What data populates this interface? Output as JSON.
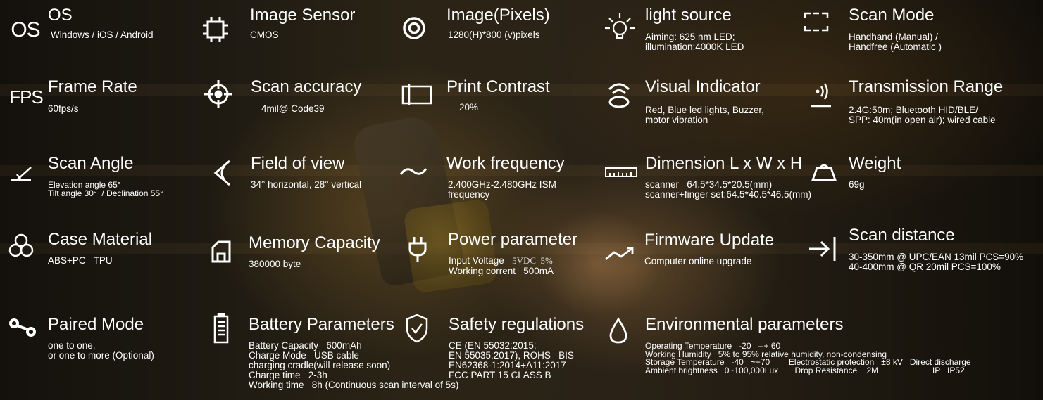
{
  "items": {
    "os": {
      "title": "OS",
      "icon_text": "OS",
      "icon": "os-text-icon",
      "text": "Windows / iOS / Android"
    },
    "image_sensor": {
      "title": "Image Sensor",
      "icon": "chip-icon",
      "text": "CMOS"
    },
    "image_pixels": {
      "title": "Image(Pixels)",
      "icon": "target-circle-icon",
      "text": "1280(H)*800 (v)pixels"
    },
    "light_source": {
      "title": "light source",
      "icon": "light-bulb-icon",
      "text": "Aiming: 625 nm LED;\nillumination:4000K LED"
    },
    "scan_mode": {
      "title": "Scan Mode",
      "icon": "scan-frame-icon",
      "text": "Handhand (Manual) /\nHandfree (Automatic )"
    },
    "frame_rate": {
      "title": "Frame Rate",
      "icon_text": "FPS",
      "icon": "fps-text-icon",
      "text": "60fps/s"
    },
    "scan_accuracy": {
      "title": "Scan accuracy",
      "icon": "crosshair-icon",
      "text": "4mil@ Code39"
    },
    "print_contrast": {
      "title": "Print Contrast",
      "icon": "contrast-rectangle-icon",
      "text": "20%"
    },
    "visual_indicator": {
      "title": "Visual Indicator",
      "icon": "signal-indicator-icon",
      "text": "Red, Blue led lights, Buzzer,\nmotor vibration"
    },
    "transmission_range": {
      "title": "Transmission Range",
      "icon": "wireless-transmit-icon",
      "text": "2.4G:50m; Bluetooth HID/BLE/\nSPP: 40m(in open air); wired cable"
    },
    "scan_angle": {
      "title": "Scan Angle",
      "icon": "angle-icon",
      "text": "Elevation angle 65°\nTilt angle 30°  / Declination 55°"
    },
    "field_of_view": {
      "title": "Field of view",
      "icon": "field-of-view-icon",
      "text": "34° horizontal, 28° vertical"
    },
    "work_frequency": {
      "title": "Work frequency",
      "icon": "wave-icon",
      "text": "2.400GHz-2.480GHz ISM\nfrequency"
    },
    "dimension": {
      "title": "Dimension L x W x H",
      "icon": "ruler-icon",
      "text": "scanner   64.5*34.5*20.5(mm)\nscanner+finger set:64.5*40.5*46.5(mm)"
    },
    "weight": {
      "title": "Weight",
      "icon": "weight-icon",
      "text": "69g"
    },
    "case_material": {
      "title": "Case Material",
      "icon": "three-circles-icon",
      "text": "ABS+PC   TPU"
    },
    "memory_capacity": {
      "title": "Memory Capacity",
      "icon": "memory-card-icon",
      "text": "380000 byte"
    },
    "power_parameter": {
      "title": "Power parameter",
      "icon": "plug-icon",
      "line1_label": "Input Voltage",
      "line1_value": "5VDC  5%",
      "line2": "Working corrent   500mA"
    },
    "firmware_update": {
      "title": "Firmware Update",
      "icon": "trend-up-icon",
      "text": "Computer online upgrade"
    },
    "scan_distance": {
      "title": "Scan distance",
      "icon": "arrow-to-bar-icon",
      "text": "30-350mm @ UPC/EAN 13mil PCS=90%\n40-400mm @ QR 20mil PCS=100%"
    },
    "paired_mode": {
      "title": "Paired Mode",
      "icon": "link-icon",
      "text": "one to one,\nor one to more (Optional)"
    },
    "battery_parameters": {
      "title": "Battery Parameters",
      "icon": "battery-icon",
      "text": "Battery Capacity   600mAh\nCharge Mode   USB cable\ncharging cradle(will release soon)\nCharge time   2-3h\nWorking time   8h (Continuous scan interval of 5s)"
    },
    "safety_regulations": {
      "title": "Safety regulations",
      "icon": "shield-check-icon",
      "text": "CE (EN 55032:2015;\nEN 55035:2017), ROHS   BIS\nEN62368-1:2014+A11:2017\nFCC PART 15 CLASS B"
    },
    "environmental_parameters": {
      "title": "Environmental parameters",
      "icon": "water-drop-icon",
      "text": "Operating Temperature   -20   --+ 60\nWorking Humidity   5% to 95% relative humidity, non-condensing\nStorage Temperature   -40   ~+70        Electrostatic protection   ±8 kV   Direct discharge\nAmbient brightness   0~100,000Lux       Drop Resistance    2M                       IP   IP52"
    }
  }
}
